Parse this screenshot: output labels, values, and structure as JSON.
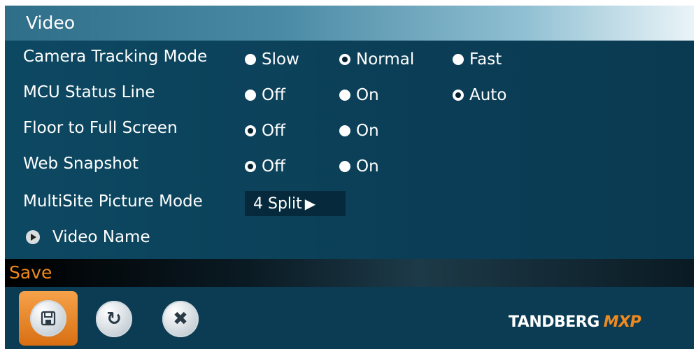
{
  "window": {
    "title": "Video"
  },
  "settings": [
    {
      "label": "Camera Tracking Mode",
      "options": [
        {
          "label": "Slow",
          "selected": false
        },
        {
          "label": "Normal",
          "selected": true
        },
        {
          "label": "Fast",
          "selected": false
        }
      ]
    },
    {
      "label": "MCU Status Line",
      "options": [
        {
          "label": "Off",
          "selected": false
        },
        {
          "label": "On",
          "selected": false
        },
        {
          "label": "Auto",
          "selected": true
        }
      ]
    },
    {
      "label": "Floor to Full Screen",
      "options": [
        {
          "label": "Off",
          "selected": true
        },
        {
          "label": "On",
          "selected": false
        }
      ]
    },
    {
      "label": "Web Snapshot",
      "options": [
        {
          "label": "Off",
          "selected": true
        },
        {
          "label": "On",
          "selected": false
        }
      ]
    }
  ],
  "multisite": {
    "label": "MultiSite Picture Mode",
    "value": "4 Split"
  },
  "video_name": {
    "label": "Video Name"
  },
  "savebar": {
    "label": "Save"
  },
  "footer": {
    "buttons": [
      {
        "icon": "save-icon"
      },
      {
        "icon": "refresh-icon"
      },
      {
        "icon": "close-icon"
      }
    ],
    "logo_main": "TANDBERG",
    "logo_sub": "MXP"
  },
  "colors": {
    "accent": "#f08a1e",
    "panel": "#0b3c53"
  }
}
